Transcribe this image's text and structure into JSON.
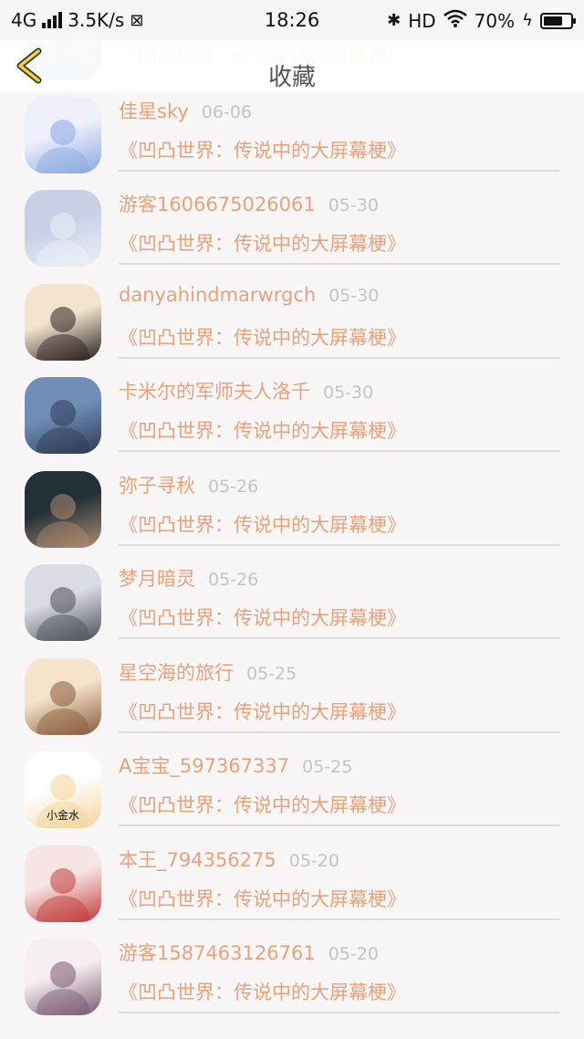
{
  "status_bar": {
    "network": "4G",
    "speed": "3.5K/s",
    "time": "18:26",
    "hd": "HD",
    "battery": "70%",
    "battery_level": 0.7
  },
  "nav": {
    "back_icon": "chevron-left-icon",
    "title": "收藏"
  },
  "items": [
    {
      "name": "",
      "date": "",
      "title": "《凹凸世界：传说中的大屏幕梗》",
      "colors": [
        "#9ab9c9",
        "#5a7f96"
      ]
    },
    {
      "name": "佳星sky",
      "date": "06-06",
      "title": "《凹凸世界：传说中的大屏幕梗》",
      "colors": [
        "#eef0fb",
        "#8aa8e0"
      ]
    },
    {
      "name": "游客1606675026061",
      "date": "05-30",
      "title": "《凹凸世界：传说中的大屏幕梗》",
      "colors": [
        "#c7d0e6",
        "#eef1f8"
      ]
    },
    {
      "name": "danyahindmarwrgch",
      "date": "05-30",
      "title": "《凹凸世界：传说中的大屏幕梗》",
      "colors": [
        "#f3e4cf",
        "#2a2020"
      ]
    },
    {
      "name": "卡米尔的军师夫人洛千",
      "date": "05-30",
      "title": "《凹凸世界：传说中的大屏幕梗》",
      "colors": [
        "#6f8fb8",
        "#2f3a55"
      ]
    },
    {
      "name": "弥子寻秋",
      "date": "05-26",
      "title": "《凹凸世界：传说中的大屏幕梗》",
      "colors": [
        "#223038",
        "#b08c70"
      ]
    },
    {
      "name": "梦月暗灵",
      "date": "05-26",
      "title": "《凹凸世界：传说中的大屏幕梗》",
      "colors": [
        "#d9dce3",
        "#4b4f5a"
      ]
    },
    {
      "name": "星空海的旅行",
      "date": "05-25",
      "title": "《凹凸世界：传说中的大屏幕梗》",
      "colors": [
        "#f5e3cc",
        "#8a5a3a"
      ]
    },
    {
      "name": "A宝宝_597367337",
      "date": "05-25",
      "title": "《凹凸世界：传说中的大屏幕梗》",
      "colors": [
        "#ffffff",
        "#f2d59a"
      ],
      "avatar_text": "小金水"
    },
    {
      "name": "本王_794356275",
      "date": "05-20",
      "title": "《凹凸世界：传说中的大屏幕梗》",
      "colors": [
        "#f7e4e4",
        "#c23a3a"
      ]
    },
    {
      "name": "游客1587463126761",
      "date": "05-20",
      "title": "《凹凸世界：传说中的大屏幕梗》",
      "colors": [
        "#f6eef2",
        "#7a5a70"
      ]
    }
  ]
}
